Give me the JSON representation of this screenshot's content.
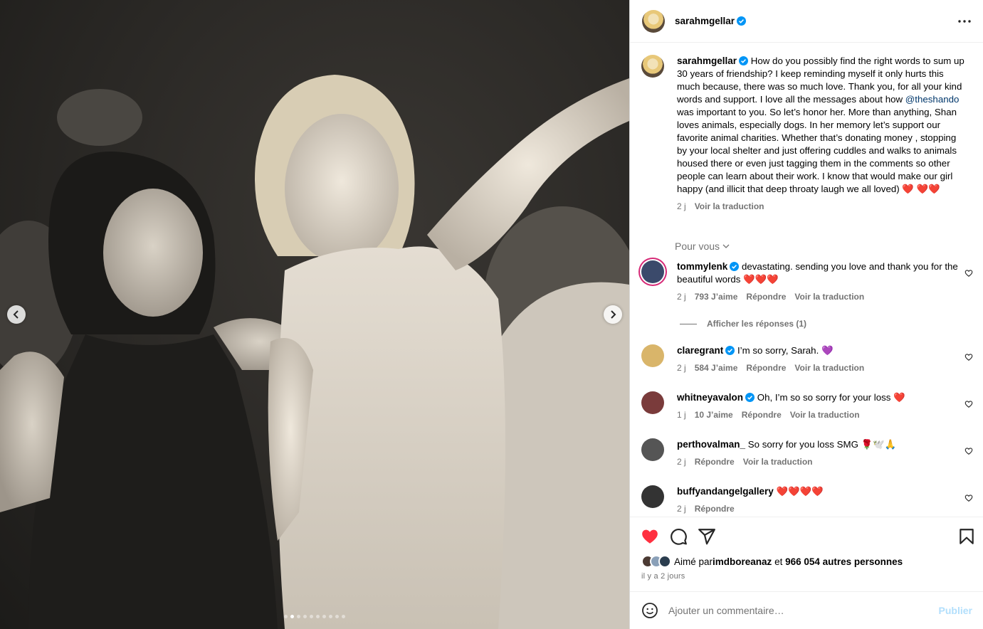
{
  "post": {
    "author": "sarahmgellar",
    "caption_text": "How do you possibly find the right words to sum up 30 years of friendship? I keep reminding myself it only hurts this much because, there was so much love. Thank you, for all your kind words and support. I love all the messages about how ",
    "caption_mention": "@theshando",
    "caption_rest": " was important to you. So let’s honor her. More than anything, Shan loves animals, especially dogs. In her memory let’s support our favorite animal charities. Whether that’s donating money , stopping by your local shelter and just offering cuddles and walks to animals housed there or even just tagging them in the comments so other people can learn about their work. I know that would make our girl happy (and illicit that deep throaty laugh we all loved) ",
    "caption_hearts": "❤️ ❤️❤️",
    "caption_time": "2 j",
    "see_translation": "Voir la traduction",
    "carousel_count": 10,
    "carousel_active": 1
  },
  "for_you_label": "Pour vous",
  "comments": [
    {
      "user": "tommylenk",
      "verified": true,
      "text": "devastating. sending you love and thank you for the beautiful words ",
      "hearts": "❤️❤️❤️",
      "time": "2 j",
      "likes": "793 J’aime",
      "reply": "Répondre",
      "translate": "Voir la traduction",
      "avatar_color": "#3b4a6b"
    },
    {
      "user": "claregrant",
      "verified": true,
      "text": "I’m so sorry, Sarah. ",
      "hearts": "💜",
      "time": "2 j",
      "likes": "584 J’aime",
      "reply": "Répondre",
      "translate": "Voir la traduction",
      "avatar_color": "#d9b56a"
    },
    {
      "user": "whitneyavalon",
      "verified": true,
      "text": "Oh, I’m so so sorry for your loss ",
      "hearts": "❤️",
      "time": "1 j",
      "likes": "10 J’aime",
      "reply": "Répondre",
      "translate": "Voir la traduction",
      "avatar_color": "#7a3b3b"
    },
    {
      "user": "perthovalman_",
      "verified": false,
      "text": "So sorry for you loss SMG ",
      "hearts": "🌹🕊️🙏",
      "time": "2 j",
      "likes": "",
      "reply": "Répondre",
      "translate": "Voir la traduction",
      "avatar_color": "#555555"
    },
    {
      "user": "buffyandangelgallery",
      "verified": false,
      "text": "",
      "hearts": "❤️❤️❤️❤️",
      "time": "2 j",
      "likes": "",
      "reply": "Répondre",
      "translate": "",
      "avatar_color": "#333333"
    }
  ],
  "view_replies": "Afficher les réponses (1)",
  "likes_line": {
    "prefix": "Aimé par ",
    "user": "imdboreanaz",
    "middle": " et ",
    "count": "966 054 autres personnes"
  },
  "posted_ago": "il y a 2 jours",
  "composer": {
    "placeholder": "Ajouter un commentaire…",
    "publish": "Publier"
  },
  "colors": {
    "liked": "#ff3040",
    "verified": "#0095f6",
    "link": "#00376b",
    "muted": "#737373"
  }
}
